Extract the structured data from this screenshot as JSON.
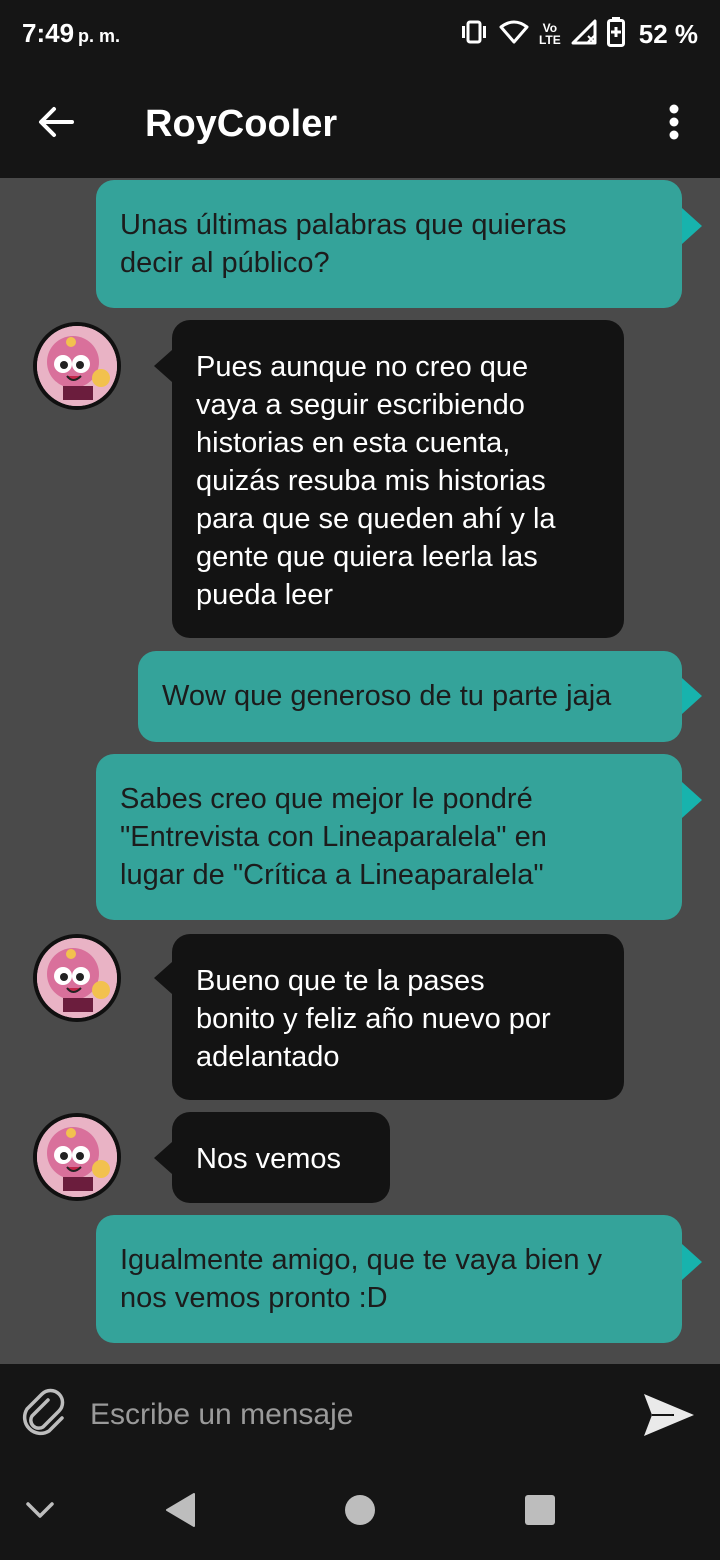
{
  "status_bar": {
    "time": "7:49",
    "ampm": "p. m.",
    "lte_top": "Vo",
    "lte_bottom": "LTE",
    "battery_percent": "52 %"
  },
  "app_bar": {
    "title": "RoyCooler",
    "back_icon": "arrow-left-icon",
    "menu_icon": "more-vertical-icon"
  },
  "messages": [
    {
      "direction": "sent",
      "lines": [
        "Unas últimas palabras que quieras",
        "decir al público?"
      ]
    },
    {
      "direction": "received",
      "lines": [
        "Pues aunque no creo que",
        "vaya a seguir escribiendo",
        "historias en esta cuenta,",
        "quizás resuba mis historias",
        "para que se queden ahí y la",
        "gente que quiera leerla las",
        "pueda leer"
      ]
    },
    {
      "direction": "sent",
      "lines": [
        "Wow que generoso de tu parte jaja"
      ]
    },
    {
      "direction": "sent",
      "lines": [
        "Sabes creo que mejor le pondré",
        "\"Entrevista con Lineaparalela\" en",
        "lugar de \"Crítica a Lineaparalela\""
      ]
    },
    {
      "direction": "received",
      "lines": [
        "Bueno que te la pases",
        "bonito y feliz año nuevo por",
        "adelantado"
      ]
    },
    {
      "direction": "received",
      "lines": [
        "Nos vemos"
      ]
    },
    {
      "direction": "sent",
      "lines": [
        "Igualmente amigo, que te vaya bien y",
        "nos vemos pronto :D"
      ]
    }
  ],
  "input": {
    "placeholder": "Escribe un mensaje",
    "attach_icon": "paperclip-icon",
    "send_icon": "send-icon"
  },
  "nav": {
    "icons": [
      "chevron-down-icon",
      "back-triangle-icon",
      "home-circle-icon",
      "recents-square-icon"
    ]
  },
  "colors": {
    "sent_bubble": "#34a39a",
    "received_bubble": "#131313",
    "chat_background": "#4a4a4a",
    "bars": "#151515"
  }
}
